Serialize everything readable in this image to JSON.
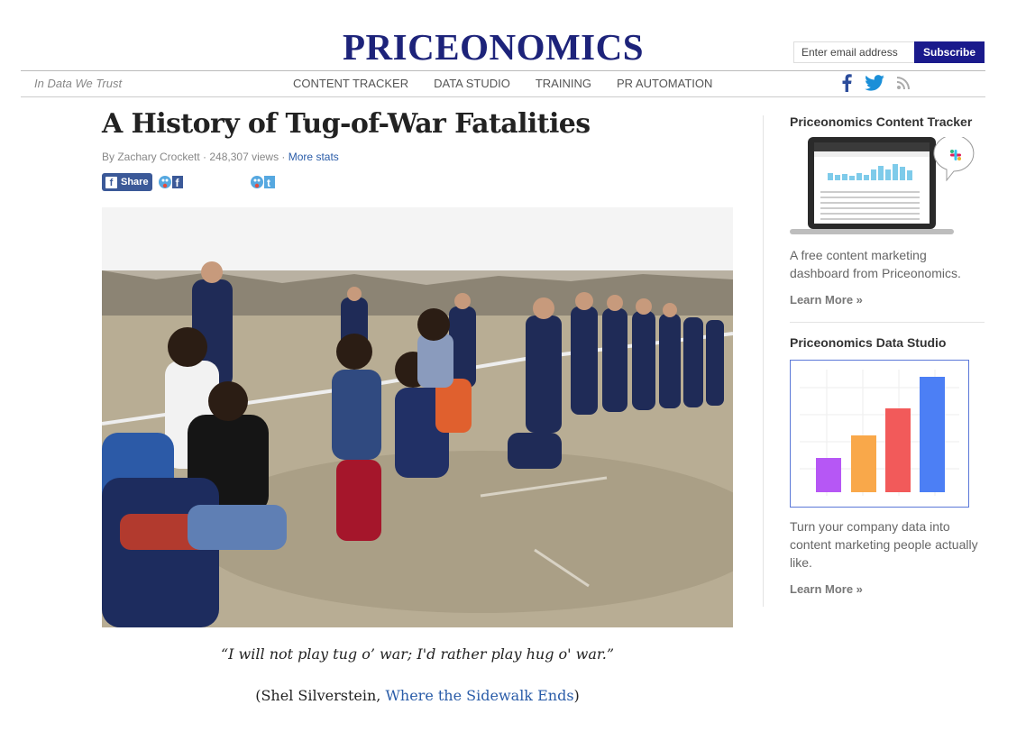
{
  "header": {
    "logo": "PRICEONOMICS",
    "email_placeholder": "Enter email address",
    "subscribe_label": "Subscribe"
  },
  "nav": {
    "tagline": "In Data We Trust",
    "links": [
      "CONTENT TRACKER",
      "DATA STUDIO",
      "TRAINING",
      "PR AUTOMATION"
    ],
    "social_icons": [
      "facebook-icon",
      "twitter-icon",
      "rss-icon"
    ]
  },
  "article": {
    "title": "A History of Tug-of-War Fatalities",
    "author": "By Zachary Crockett",
    "views": "248,307 views",
    "more_stats": "More stats",
    "share_label": "Share",
    "quote": "“I will not play tug o’ war; I'd rather play hug o' war.”",
    "citation_open": "(Shel Silverstein, ",
    "citation_link": "Where the Sidewalk Ends",
    "citation_close": ")"
  },
  "sidebar": {
    "tracker": {
      "title": "Priceonomics Content Tracker",
      "text": "A free content marketing dashboard from Priceonomics.",
      "link": "Learn More »"
    },
    "studio": {
      "title": "Priceonomics Data Studio",
      "text": "Turn your company data into content marketing people actually like.",
      "link": "Learn More »",
      "bar_colors": [
        "#b657f5",
        "#f9a84a",
        "#f25a5a",
        "#4c7ff5"
      ]
    }
  },
  "colors": {
    "brand_navy": "#1d237a",
    "subscribe_bg": "#1a1a8c",
    "link_blue": "#2a5ca8",
    "facebook_blue": "#3b5998",
    "twitter_blue": "#1da1f2"
  }
}
